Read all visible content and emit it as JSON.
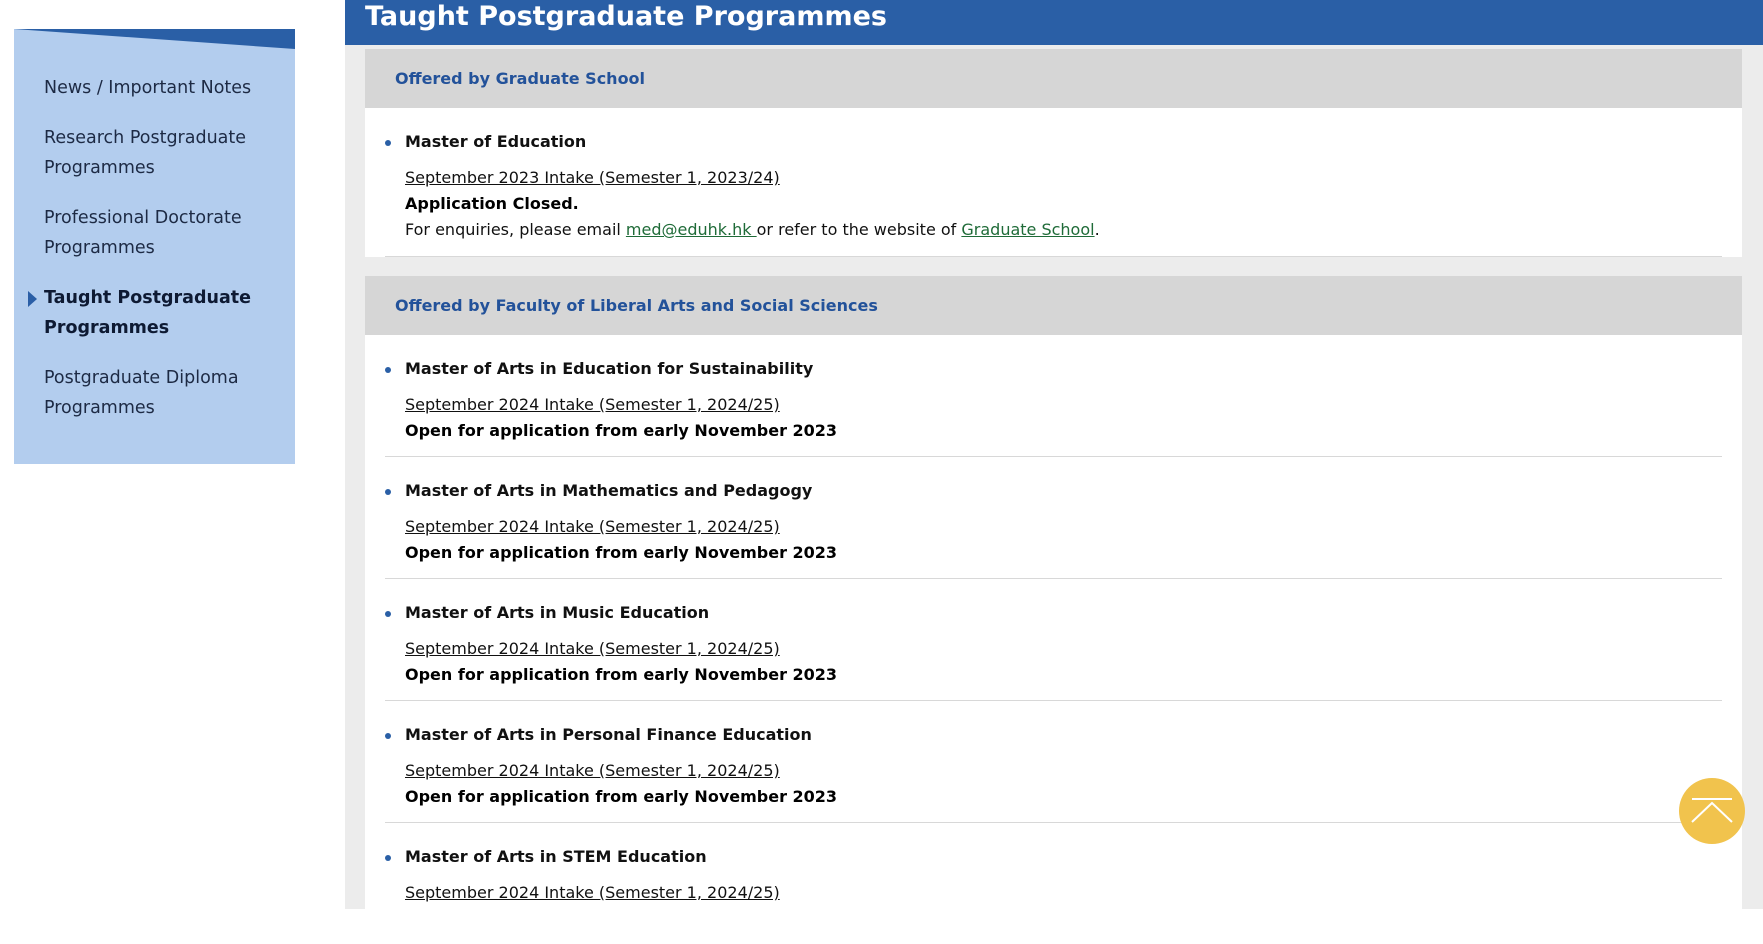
{
  "sidebar": {
    "items": [
      {
        "label": "News / Important Notes",
        "active": false
      },
      {
        "label": "Research Postgraduate Programmes",
        "active": false
      },
      {
        "label": "Professional Doctorate Programmes",
        "active": false
      },
      {
        "label": "Taught Postgraduate Programmes",
        "active": true
      },
      {
        "label": "Postgraduate Diploma Programmes",
        "active": false
      }
    ]
  },
  "page": {
    "title": "Taught Postgraduate Programmes"
  },
  "sections": [
    {
      "header": "Offered by Graduate School",
      "programs": [
        {
          "name": "Master of Education",
          "intake": "September 2023 Intake (Semester 1, 2023/24)",
          "status": "Application Closed.",
          "enquiry_prefix": "For enquiries, please email ",
          "email": "med@eduhk.hk ",
          "enquiry_middle": " or refer to the website of ",
          "website_link": "Graduate School",
          "enquiry_suffix": "."
        }
      ]
    },
    {
      "header": "Offered by Faculty of Liberal Arts and Social Sciences",
      "programs": [
        {
          "name": "Master of Arts in Education for Sustainability",
          "intake": "September 2024 Intake (Semester 1, 2024/25)",
          "status": "Open for application from early November 2023"
        },
        {
          "name": "Master of Arts in Mathematics and Pedagogy",
          "intake": "September 2024 Intake (Semester 1, 2024/25)",
          "status": "Open for application from early November 2023"
        },
        {
          "name": "Master of Arts in Music Education",
          "intake": "September 2024 Intake (Semester 1, 2024/25)",
          "status": "Open for application from early November 2023"
        },
        {
          "name": "Master of Arts in Personal Finance Education",
          "intake": "September 2024 Intake (Semester 1, 2024/25)",
          "status": "Open for application from early November 2023"
        },
        {
          "name": "Master of Arts in STEM Education",
          "intake": "September 2024 Intake (Semester 1, 2024/25)",
          "status": ""
        }
      ]
    }
  ],
  "colors": {
    "title_bar": "#2a5fa6",
    "sidebar_bg": "#b3cdee",
    "section_header_bg": "#d6d6d6",
    "section_header_text": "#23529a",
    "link_green": "#1f6b38",
    "scroll_button": "#f1c34d"
  },
  "icons": {
    "scroll_top": "chevron-up-icon",
    "active_nav": "caret-right-icon"
  }
}
